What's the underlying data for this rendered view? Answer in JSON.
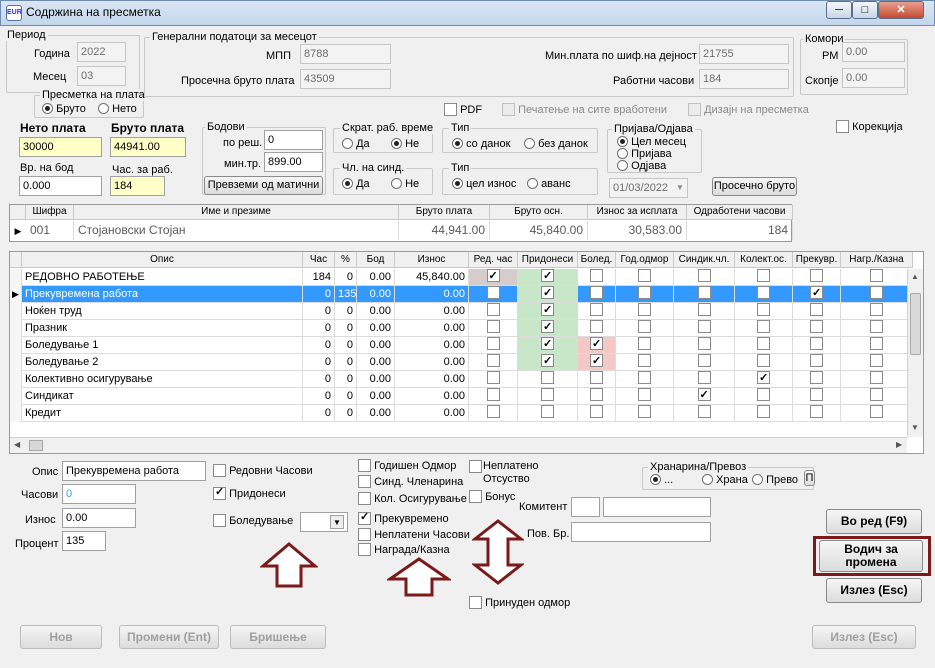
{
  "window": {
    "title": "Содржина на пресметка",
    "icon": "app-icon",
    "minimize": "─",
    "maximize": "□",
    "close": "✕"
  },
  "period": {
    "label": "Период",
    "year_label": "Година",
    "year": "2022",
    "month_label": "Месец",
    "month": "03"
  },
  "general": {
    "label": "Генерални податоци за месецот",
    "mpp_label": "МПП",
    "mpp": "8788",
    "avg_label": "Просечна бруто плата",
    "avg": "43509",
    "min_label": "Мин.плата по шиф.на дејност",
    "min": "21755",
    "hours_label": "Работни часови",
    "hours": "184"
  },
  "komori": {
    "label": "Комори",
    "rm_label": "РМ",
    "rm": "0.00",
    "skopje_label": "Скопје",
    "skopje": "0.00"
  },
  "calc": {
    "label": "Пресметка на плата",
    "bruto": "Бруто",
    "neto": "Нето"
  },
  "options": {
    "pdf": "PDF",
    "print_all": "Печатење на сите вработени",
    "design": "Дизајн на пресметка",
    "correction": "Корекција"
  },
  "net": {
    "label": "Нето плата",
    "value": "30000"
  },
  "gross": {
    "label": "Бруто плата",
    "value": "44941.00"
  },
  "vr_bod": {
    "label": "Вр. на бод",
    "value": "0.000"
  },
  "hours_work": {
    "label": "Час. за раб.",
    "value": "184"
  },
  "bodovi": {
    "label": "Бодови",
    "po_res_label": "по реш.",
    "po_res": "0",
    "min_tr_label": "мин.тр.",
    "min_tr": "899.00",
    "button": "Превземи од матични"
  },
  "skrat": {
    "label": "Скрат. раб. време",
    "yes": "Да",
    "no": "Не"
  },
  "synd": {
    "label": "Чл. на синд.",
    "yes": "Да",
    "no": "Не"
  },
  "tip1": {
    "label": "Тип",
    "a": "со данок",
    "b": "без данок"
  },
  "tip2": {
    "label": "Тип",
    "a": "цел износ",
    "b": "аванс"
  },
  "prijava": {
    "label": "Пријава/Одјава",
    "a": "Цел месец",
    "b": "Пријава",
    "c": "Одјава",
    "date": "01/03/2022",
    "button": "Просечно бруто"
  },
  "emp": {
    "headers": [
      "Шифра",
      "Име и презиме",
      "Бруто плата",
      "Бруто осн.",
      "Износ за исплата",
      "Одработени часови"
    ],
    "row": [
      "001",
      "Стојановски Стојан",
      "44,941.00",
      "45,840.00",
      "30,583.00",
      "184"
    ]
  },
  "items": {
    "headers": [
      "Опис",
      "Час",
      "%",
      "Бод",
      "Износ",
      "Ред. час",
      "Придонеси",
      "Болед.",
      "Год.одмор",
      "Синдик.чл.",
      "Колект.ос.",
      "Прекувр.",
      "Нагр./Казна"
    ],
    "rows": [
      {
        "c": [
          "РЕДОВНО РАБОТЕЊЕ",
          "184",
          "0",
          "0.00",
          "45,840.00"
        ],
        "k": [
          1,
          1,
          0,
          0,
          0,
          0,
          0,
          0
        ]
      },
      {
        "c": [
          "Прекувремена работа",
          "0",
          "135",
          "0.00",
          "0.00"
        ],
        "k": [
          0,
          1,
          0,
          0,
          0,
          0,
          1,
          0
        ]
      },
      {
        "c": [
          "Ноќен труд",
          "0",
          "0",
          "0.00",
          "0.00"
        ],
        "k": [
          0,
          1,
          0,
          0,
          0,
          0,
          0,
          0
        ]
      },
      {
        "c": [
          "Празник",
          "0",
          "0",
          "0.00",
          "0.00"
        ],
        "k": [
          0,
          1,
          0,
          0,
          0,
          0,
          0,
          0
        ]
      },
      {
        "c": [
          "Боледување 1",
          "0",
          "0",
          "0.00",
          "0.00"
        ],
        "k": [
          0,
          1,
          1,
          0,
          0,
          0,
          0,
          0
        ]
      },
      {
        "c": [
          "Боледување 2",
          "0",
          "0",
          "0.00",
          "0.00"
        ],
        "k": [
          0,
          1,
          1,
          0,
          0,
          0,
          0,
          0
        ]
      },
      {
        "c": [
          "Колективно осигурување",
          "0",
          "0",
          "0.00",
          "0.00"
        ],
        "k": [
          0,
          0,
          0,
          0,
          0,
          1,
          0,
          0
        ]
      },
      {
        "c": [
          "Синдикат",
          "0",
          "0",
          "0.00",
          "0.00"
        ],
        "k": [
          0,
          0,
          0,
          0,
          1,
          0,
          0,
          0
        ]
      },
      {
        "c": [
          "Кредит",
          "0",
          "0",
          "0.00",
          "0.00"
        ],
        "k": [
          0,
          0,
          0,
          0,
          0,
          0,
          0,
          0
        ]
      }
    ]
  },
  "detail": {
    "opis_label": "Опис",
    "opis": "Прекувремена работа",
    "casovi_label": "Часови",
    "casovi": "0",
    "iznos_label": "Износ",
    "iznos": "0.00",
    "procent_label": "Процент",
    "procent": "135",
    "regular": "Редовни Часови",
    "pridonesi": "Придонеси",
    "boleduvanje": "Боледување",
    "godisen": "Годишен Одмор",
    "sind": "Синд. Членарина",
    "kol": "Кол. Осигурување",
    "prek": "Прекувремено",
    "neplateni": "Неплатени Часови",
    "nagrada": "Награда/Казна",
    "neplateno": "Неплатено Отсуство",
    "bonus": "Бонус",
    "komitent": "Комитент",
    "pov_br": "Пов. Бр.",
    "prinuden": "Принуден одмор",
    "hran_label": "Хранарина/Превоз",
    "hran_a": "...",
    "hran_b": "Храна",
    "hran_c": "Прево",
    "hran_btn": "П"
  },
  "buttons": {
    "vo_red": "Во ред (F9)",
    "vodic_a": "Водич за",
    "vodic_b": "промена",
    "izlez": "Излез (Esc)",
    "nov": "Нов",
    "promeni": "Промени (Ent)",
    "brisenje": "Бришење",
    "izlez2": "Излез (Esc)"
  },
  "colors": {
    "accent": "#3399ff",
    "highlight": "#7a1a1a",
    "arrow": "#7a1a1a",
    "green": "#c8e6c8",
    "pink": "#f5c8c8"
  }
}
